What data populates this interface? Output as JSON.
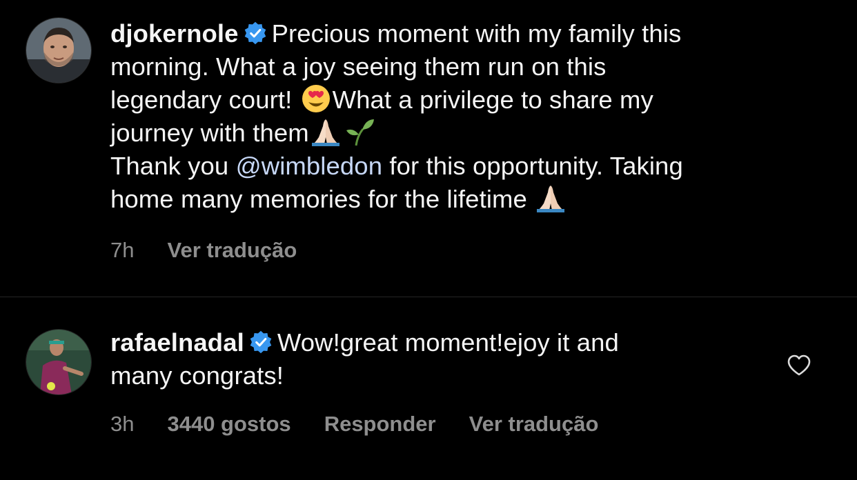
{
  "post": {
    "username": "djokernole",
    "verified": true,
    "caption_lines": [
      "Precious moment with my family this",
      "morning. What a joy seeing them run on this",
      "legendary court!",
      "What a privilege to share my",
      "journey with them"
    ],
    "thanks_prefix": "Thank you ",
    "mention": "@wimbledon",
    "thanks_suffix": " for this opportunity. Taking",
    "thanks_line2": "home many memories for the lifetime",
    "time": "7h",
    "translate_label": "Ver tradução",
    "emojis": [
      "heart-eyes-emoji",
      "folded-hands-emoji",
      "seedling-emoji",
      "folded-hands-emoji"
    ]
  },
  "comment": {
    "username": "rafaelnadal",
    "verified": true,
    "text_line1": "Wow!great moment!ejoy it and",
    "text_line2": "many congrats!",
    "time": "3h",
    "likes": "3440 gostos",
    "reply_label": "Responder",
    "translate_label": "Ver tradução"
  },
  "colors": {
    "background": "#000000",
    "text": "#f5f5f5",
    "secondary": "#8e8e8e",
    "verified_blue": "#3897f0",
    "divider": "#262626"
  }
}
